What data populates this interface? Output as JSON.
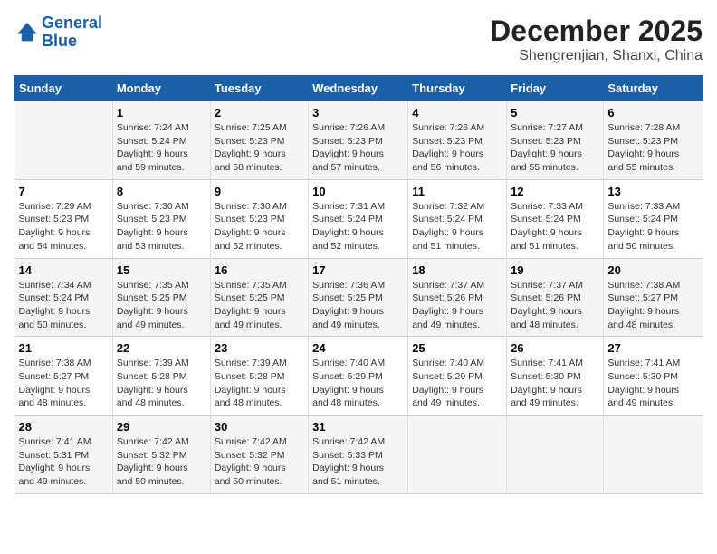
{
  "header": {
    "logo_line1": "General",
    "logo_line2": "Blue",
    "month": "December 2025",
    "location": "Shengrenjian, Shanxi, China"
  },
  "days_of_week": [
    "Sunday",
    "Monday",
    "Tuesday",
    "Wednesday",
    "Thursday",
    "Friday",
    "Saturday"
  ],
  "weeks": [
    [
      {
        "day": "",
        "info": ""
      },
      {
        "day": "1",
        "info": "Sunrise: 7:24 AM\nSunset: 5:24 PM\nDaylight: 9 hours\nand 59 minutes."
      },
      {
        "day": "2",
        "info": "Sunrise: 7:25 AM\nSunset: 5:23 PM\nDaylight: 9 hours\nand 58 minutes."
      },
      {
        "day": "3",
        "info": "Sunrise: 7:26 AM\nSunset: 5:23 PM\nDaylight: 9 hours\nand 57 minutes."
      },
      {
        "day": "4",
        "info": "Sunrise: 7:26 AM\nSunset: 5:23 PM\nDaylight: 9 hours\nand 56 minutes."
      },
      {
        "day": "5",
        "info": "Sunrise: 7:27 AM\nSunset: 5:23 PM\nDaylight: 9 hours\nand 55 minutes."
      },
      {
        "day": "6",
        "info": "Sunrise: 7:28 AM\nSunset: 5:23 PM\nDaylight: 9 hours\nand 55 minutes."
      }
    ],
    [
      {
        "day": "7",
        "info": "Sunrise: 7:29 AM\nSunset: 5:23 PM\nDaylight: 9 hours\nand 54 minutes."
      },
      {
        "day": "8",
        "info": "Sunrise: 7:30 AM\nSunset: 5:23 PM\nDaylight: 9 hours\nand 53 minutes."
      },
      {
        "day": "9",
        "info": "Sunrise: 7:30 AM\nSunset: 5:23 PM\nDaylight: 9 hours\nand 52 minutes."
      },
      {
        "day": "10",
        "info": "Sunrise: 7:31 AM\nSunset: 5:24 PM\nDaylight: 9 hours\nand 52 minutes."
      },
      {
        "day": "11",
        "info": "Sunrise: 7:32 AM\nSunset: 5:24 PM\nDaylight: 9 hours\nand 51 minutes."
      },
      {
        "day": "12",
        "info": "Sunrise: 7:33 AM\nSunset: 5:24 PM\nDaylight: 9 hours\nand 51 minutes."
      },
      {
        "day": "13",
        "info": "Sunrise: 7:33 AM\nSunset: 5:24 PM\nDaylight: 9 hours\nand 50 minutes."
      }
    ],
    [
      {
        "day": "14",
        "info": "Sunrise: 7:34 AM\nSunset: 5:24 PM\nDaylight: 9 hours\nand 50 minutes."
      },
      {
        "day": "15",
        "info": "Sunrise: 7:35 AM\nSunset: 5:25 PM\nDaylight: 9 hours\nand 49 minutes."
      },
      {
        "day": "16",
        "info": "Sunrise: 7:35 AM\nSunset: 5:25 PM\nDaylight: 9 hours\nand 49 minutes."
      },
      {
        "day": "17",
        "info": "Sunrise: 7:36 AM\nSunset: 5:25 PM\nDaylight: 9 hours\nand 49 minutes."
      },
      {
        "day": "18",
        "info": "Sunrise: 7:37 AM\nSunset: 5:26 PM\nDaylight: 9 hours\nand 49 minutes."
      },
      {
        "day": "19",
        "info": "Sunrise: 7:37 AM\nSunset: 5:26 PM\nDaylight: 9 hours\nand 48 minutes."
      },
      {
        "day": "20",
        "info": "Sunrise: 7:38 AM\nSunset: 5:27 PM\nDaylight: 9 hours\nand 48 minutes."
      }
    ],
    [
      {
        "day": "21",
        "info": "Sunrise: 7:38 AM\nSunset: 5:27 PM\nDaylight: 9 hours\nand 48 minutes."
      },
      {
        "day": "22",
        "info": "Sunrise: 7:39 AM\nSunset: 5:28 PM\nDaylight: 9 hours\nand 48 minutes."
      },
      {
        "day": "23",
        "info": "Sunrise: 7:39 AM\nSunset: 5:28 PM\nDaylight: 9 hours\nand 48 minutes."
      },
      {
        "day": "24",
        "info": "Sunrise: 7:40 AM\nSunset: 5:29 PM\nDaylight: 9 hours\nand 48 minutes."
      },
      {
        "day": "25",
        "info": "Sunrise: 7:40 AM\nSunset: 5:29 PM\nDaylight: 9 hours\nand 49 minutes."
      },
      {
        "day": "26",
        "info": "Sunrise: 7:41 AM\nSunset: 5:30 PM\nDaylight: 9 hours\nand 49 minutes."
      },
      {
        "day": "27",
        "info": "Sunrise: 7:41 AM\nSunset: 5:30 PM\nDaylight: 9 hours\nand 49 minutes."
      }
    ],
    [
      {
        "day": "28",
        "info": "Sunrise: 7:41 AM\nSunset: 5:31 PM\nDaylight: 9 hours\nand 49 minutes."
      },
      {
        "day": "29",
        "info": "Sunrise: 7:42 AM\nSunset: 5:32 PM\nDaylight: 9 hours\nand 50 minutes."
      },
      {
        "day": "30",
        "info": "Sunrise: 7:42 AM\nSunset: 5:32 PM\nDaylight: 9 hours\nand 50 minutes."
      },
      {
        "day": "31",
        "info": "Sunrise: 7:42 AM\nSunset: 5:33 PM\nDaylight: 9 hours\nand 51 minutes."
      },
      {
        "day": "",
        "info": ""
      },
      {
        "day": "",
        "info": ""
      },
      {
        "day": "",
        "info": ""
      }
    ]
  ]
}
